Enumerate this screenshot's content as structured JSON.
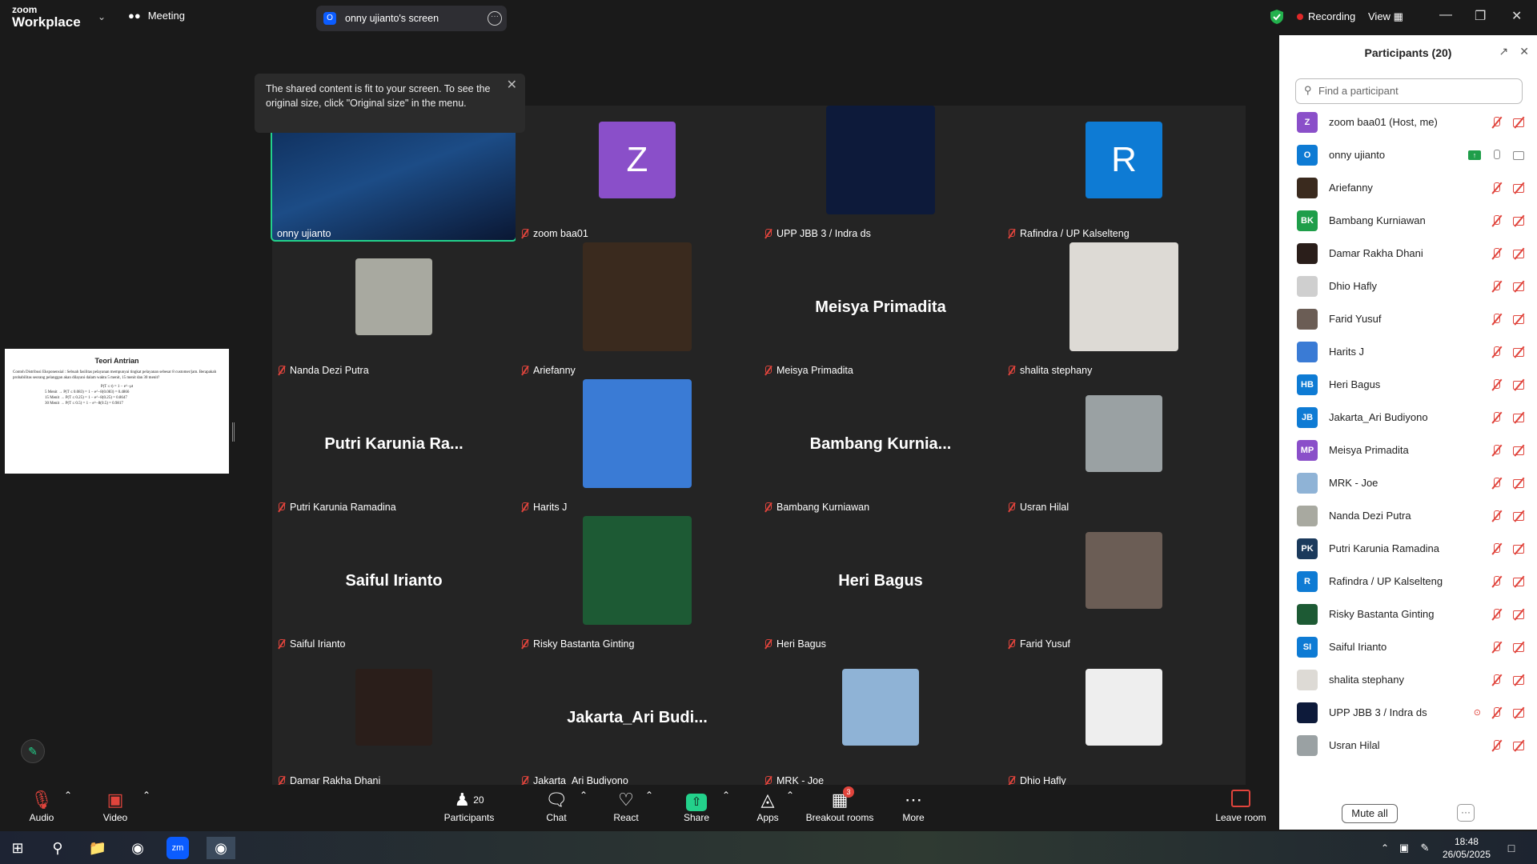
{
  "titlebar": {
    "logo_line1": "zoom",
    "logo_line2": "Workplace",
    "meeting_label": "Meeting",
    "screen_share_label": "onny ujianto's screen",
    "screen_share_initial": "O",
    "recording_label": "Recording",
    "view_label": "View"
  },
  "tooltip": {
    "text": "The shared content is fit to your screen. To see the original size, click \"Original size\" in the menu."
  },
  "slide": {
    "title": "Teori Antrian",
    "body": "Contoh Distribusi Eksponensial : Sebuah fasilitas pelayanan mempunyai tingkat pelayanan sebesar 8 customer/jam. Berapakah probabilitas seorang pelanggan akan dilayani dalam waktu 5 menit, 15 menit dan 30 menit?",
    "eq1": "P(T ≤ t) = 1 − e^−μt",
    "row1": "5 Menit →   P(T ≤ 0.083) = 1 − e^−8(0.083) = 0.4866",
    "row2": "15 Menit →  P(T ≤ 0.25) = 1 − e^−8(0.25) = 0.8647",
    "row3": "30 Menit →  P(T ≤ 0.5) = 1 − e^−8(0.5) = 0.9817"
  },
  "tiles": [
    {
      "name": "onny ujianto",
      "kind": "video"
    },
    {
      "name": "zoom baa01",
      "kind": "initial",
      "initial": "Z",
      "color": "#8a4fc9"
    },
    {
      "name": "UPP JBB 3 / Indra ds",
      "kind": "image",
      "color": "#0d1a3a"
    },
    {
      "name": "Rafindra / UP Kalselteng",
      "kind": "initial",
      "initial": "R",
      "color": "#0e7bd4"
    },
    {
      "name": "Nanda Dezi Putra",
      "kind": "image",
      "color": "#a8a9a0"
    },
    {
      "name": "Ariefanny",
      "kind": "image",
      "color": "#3a2a1e"
    },
    {
      "name": "Meisya Primadita",
      "kind": "text",
      "big": "Meisya Primadita"
    },
    {
      "name": "shalita stephany",
      "kind": "image",
      "color": "#dddad5"
    },
    {
      "name": "Putri Karunia Ramadina",
      "kind": "text",
      "big": "Putri Karunia Ra..."
    },
    {
      "name": "Harits J",
      "kind": "image",
      "color": "#3a7bd5"
    },
    {
      "name": "Bambang Kurniawan",
      "kind": "text",
      "big": "Bambang Kurnia..."
    },
    {
      "name": "Usran Hilal",
      "kind": "image",
      "color": "#9aa1a3"
    },
    {
      "name": "Saiful Irianto",
      "kind": "text",
      "big": "Saiful Irianto"
    },
    {
      "name": "Risky Bastanta Ginting",
      "kind": "image",
      "color": "#1d5a34"
    },
    {
      "name": "Heri Bagus",
      "kind": "text",
      "big": "Heri Bagus"
    },
    {
      "name": "Farid Yusuf",
      "kind": "image",
      "color": "#6b5d55"
    },
    {
      "name": "Damar Rakha Dhani",
      "kind": "image",
      "color": "#2a1e1a"
    },
    {
      "name": "Jakarta_Ari Budiyono",
      "kind": "text",
      "big": "Jakarta_Ari Budi..."
    },
    {
      "name": "MRK - Joe",
      "kind": "image",
      "color": "#8fb3d6"
    },
    {
      "name": "Dhio Hafly",
      "kind": "image",
      "color": "#eeeeee"
    }
  ],
  "panel": {
    "title": "Participants (20)",
    "search_placeholder": "Find a participant",
    "mute_all": "Mute all",
    "participants": [
      {
        "name": "zoom baa01 (Host, me)",
        "initials": "Z",
        "color": "#8a4fc9",
        "mic": "off",
        "video": "off"
      },
      {
        "name": "onny ujianto",
        "initials": "O",
        "color": "#0e7bd4",
        "mic": "on",
        "video": "on",
        "sharing": true
      },
      {
        "name": "Ariefanny",
        "initials": "",
        "color": "#3a2a1e",
        "mic": "off",
        "video": "off"
      },
      {
        "name": "Bambang Kurniawan",
        "initials": "BK",
        "color": "#1f9e4a",
        "mic": "off",
        "video": "off"
      },
      {
        "name": "Damar Rakha Dhani",
        "initials": "",
        "color": "#2a1e1a",
        "mic": "off",
        "video": "off"
      },
      {
        "name": "Dhio Hafly",
        "initials": "",
        "color": "#cfcfcf",
        "mic": "off",
        "video": "off"
      },
      {
        "name": "Farid Yusuf",
        "initials": "",
        "color": "#6b5d55",
        "mic": "off",
        "video": "off"
      },
      {
        "name": "Harits J",
        "initials": "",
        "color": "#3a7bd5",
        "mic": "off",
        "video": "off"
      },
      {
        "name": "Heri Bagus",
        "initials": "HB",
        "color": "#0e7bd4",
        "mic": "off",
        "video": "off"
      },
      {
        "name": "Jakarta_Ari Budiyono",
        "initials": "JB",
        "color": "#0e7bd4",
        "mic": "off",
        "video": "off"
      },
      {
        "name": "Meisya Primadita",
        "initials": "MP",
        "color": "#8a4fc9",
        "mic": "off",
        "video": "off"
      },
      {
        "name": "MRK - Joe",
        "initials": "",
        "color": "#8fb3d6",
        "mic": "off",
        "video": "off"
      },
      {
        "name": "Nanda Dezi Putra",
        "initials": "",
        "color": "#a8a9a0",
        "mic": "off",
        "video": "off"
      },
      {
        "name": "Putri Karunia Ramadina",
        "initials": "PK",
        "color": "#1b3a5c",
        "mic": "off",
        "video": "off"
      },
      {
        "name": "Rafindra / UP Kalselteng",
        "initials": "R",
        "color": "#0e7bd4",
        "mic": "off",
        "video": "off"
      },
      {
        "name": "Risky Bastanta Ginting",
        "initials": "",
        "color": "#1d5a34",
        "mic": "off",
        "video": "off"
      },
      {
        "name": "Saiful Irianto",
        "initials": "SI",
        "color": "#0e7bd4",
        "mic": "off",
        "video": "off"
      },
      {
        "name": "shalita stephany",
        "initials": "",
        "color": "#dddad5",
        "mic": "off",
        "video": "off"
      },
      {
        "name": "UPP JBB 3 / Indra ds",
        "initials": "",
        "color": "#0d1a3a",
        "mic": "off",
        "video": "off",
        "pin": true
      },
      {
        "name": "Usran Hilal",
        "initials": "",
        "color": "#9aa1a3",
        "mic": "off",
        "video": "off"
      }
    ]
  },
  "toolbar": {
    "audio": "Audio",
    "video": "Video",
    "participants": "Participants",
    "participants_count": "20",
    "chat": "Chat",
    "react": "React",
    "share": "Share",
    "apps": "Apps",
    "breakout": "Breakout rooms",
    "breakout_badge": "3",
    "more": "More",
    "leave": "Leave room"
  },
  "taskbar": {
    "time": "18:48",
    "date": "26/05/2025"
  }
}
